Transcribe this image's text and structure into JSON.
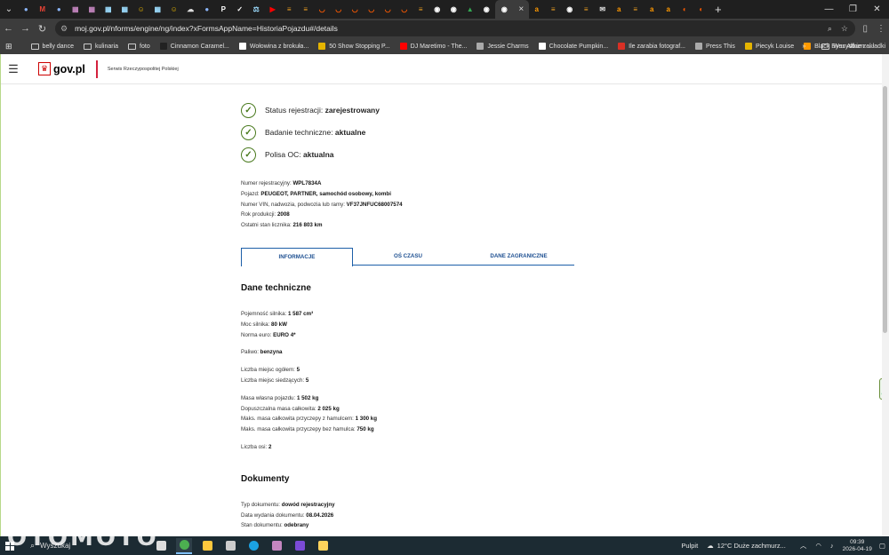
{
  "browser": {
    "tab_favicons": [
      {
        "icon": "globe-icon",
        "color": "#8ab4f8",
        "glyph": "●"
      },
      {
        "icon": "gmail-icon",
        "color": "#ea4335",
        "glyph": "M"
      },
      {
        "icon": "globe-icon",
        "color": "#8ab4f8",
        "glyph": "●"
      },
      {
        "icon": "page-icon",
        "color": "#c586c0",
        "glyph": "▦"
      },
      {
        "icon": "page-icon",
        "color": "#c586c0",
        "glyph": "▦"
      },
      {
        "icon": "page-icon",
        "color": "#9cdcfe",
        "glyph": "▦"
      },
      {
        "icon": "page-icon",
        "color": "#9cdcfe",
        "glyph": "▦"
      },
      {
        "icon": "smile-icon",
        "color": "#e5b400",
        "glyph": "☺"
      },
      {
        "icon": "page-icon",
        "color": "#9cdcfe",
        "glyph": "▦"
      },
      {
        "icon": "smile-icon",
        "color": "#e5b400",
        "glyph": "☺"
      },
      {
        "icon": "cloud-icon",
        "color": "#dddddd",
        "glyph": "☁"
      },
      {
        "icon": "globe-icon",
        "color": "#8ab4f8",
        "glyph": "●"
      },
      {
        "icon": "p-icon",
        "color": "#ffffff",
        "glyph": "P"
      },
      {
        "icon": "check-icon",
        "color": "#ffffff",
        "glyph": "✓"
      },
      {
        "icon": "scale-icon",
        "color": "#9cdcfe",
        "glyph": "⚖"
      },
      {
        "icon": "youtube-icon",
        "color": "#ff0000",
        "glyph": "▶"
      },
      {
        "icon": "olx-icon",
        "color": "#f0a020",
        "glyph": "≡"
      },
      {
        "icon": "olx-icon",
        "color": "#f0a020",
        "glyph": "≡"
      },
      {
        "icon": "allegro-icon",
        "color": "#ff5a00",
        "glyph": "◡"
      },
      {
        "icon": "allegro-icon",
        "color": "#ff5a00",
        "glyph": "◡"
      },
      {
        "icon": "allegro-icon",
        "color": "#ff5a00",
        "glyph": "◡"
      },
      {
        "icon": "allegro-icon",
        "color": "#ff5a00",
        "glyph": "◡"
      },
      {
        "icon": "allegro-icon",
        "color": "#ff5a00",
        "glyph": "◡"
      },
      {
        "icon": "allegro-icon",
        "color": "#ff5a00",
        "glyph": "◡"
      },
      {
        "icon": "olx-icon",
        "color": "#f0a020",
        "glyph": "≡"
      },
      {
        "icon": "globe-icon",
        "color": "#ffffff",
        "glyph": "◉"
      },
      {
        "icon": "globe-icon",
        "color": "#ffffff",
        "glyph": "◉"
      },
      {
        "icon": "tree-icon",
        "color": "#34a853",
        "glyph": "▲"
      },
      {
        "icon": "globe-icon",
        "color": "#ffffff",
        "glyph": "◉"
      }
    ],
    "active_tab_close": "×",
    "tab_favicons_right": [
      {
        "icon": "amazon-icon",
        "color": "#ff9900",
        "glyph": "a"
      },
      {
        "icon": "olx-icon",
        "color": "#f0a020",
        "glyph": "≡"
      },
      {
        "icon": "globe-icon",
        "color": "#ffffff",
        "glyph": "◉"
      },
      {
        "icon": "olx-icon",
        "color": "#f0a020",
        "glyph": "≡"
      },
      {
        "icon": "mail-icon",
        "color": "#dddddd",
        "glyph": "✉"
      },
      {
        "icon": "amazon-icon",
        "color": "#ff9900",
        "glyph": "a"
      },
      {
        "icon": "olx-icon",
        "color": "#f0a020",
        "glyph": "≡"
      },
      {
        "icon": "amazon-icon",
        "color": "#ff9900",
        "glyph": "a"
      },
      {
        "icon": "amazon-icon",
        "color": "#ff9900",
        "glyph": "a"
      },
      {
        "icon": "crescent-icon",
        "color": "#ff5a00",
        "glyph": "◐"
      },
      {
        "icon": "crescent-icon",
        "color": "#ff5a00",
        "glyph": "◐"
      }
    ],
    "new_tab": "+",
    "url": "moj.gov.pl/nforms/engine/ng/index?xFormsAppName=HistoriaPojazdu#/details",
    "bookmarks": [
      {
        "label": "belly dance",
        "icon": "folder-icon",
        "color": "",
        "folder": true
      },
      {
        "label": "kulinaria",
        "icon": "folder-icon",
        "color": "",
        "folder": true
      },
      {
        "label": "foto",
        "icon": "folder-icon",
        "color": "",
        "folder": true
      },
      {
        "label": "Cinnamon Caramel...",
        "icon": "bookmark-icon",
        "color": "#222222",
        "folder": false
      },
      {
        "label": "Wołowina z brokuła...",
        "icon": "bookmark-icon",
        "color": "#ffffff",
        "folder": false
      },
      {
        "label": "50 Show Stopping P...",
        "icon": "bookmark-icon",
        "color": "#e5b400",
        "folder": false
      },
      {
        "label": "DJ Maretimo - The...",
        "icon": "youtube-icon",
        "color": "#ff0000",
        "folder": false
      },
      {
        "label": "Jessie Charms",
        "icon": "globe-icon",
        "color": "#aaaaaa",
        "folder": false
      },
      {
        "label": "Chocolate Pumpkin...",
        "icon": "bookmark-icon",
        "color": "#ffffff",
        "folder": false
      },
      {
        "label": "Ile zarabia fotograf...",
        "icon": "bookmark-icon",
        "color": "#d93025",
        "folder": false
      },
      {
        "label": "Press This",
        "icon": "globe-icon",
        "color": "#aaaaaa",
        "folder": false
      },
      {
        "label": "Piecyk Louise",
        "icon": "bookmark-icon",
        "color": "#e5b400",
        "folder": false
      },
      {
        "label": "Black Eyes Album -...",
        "icon": "bookmark-icon",
        "color": "#ff9900",
        "folder": false
      }
    ],
    "bookmarks_more": "»",
    "all_bookmarks": "Wszystkie zakładki"
  },
  "site": {
    "logo_text": "gov.pl",
    "service_name": "Serwis Rzeczypospolitej Polskiej"
  },
  "statuses": [
    {
      "label": "Status rejestracji: ",
      "value": "zarejestrowany"
    },
    {
      "label": "Badanie techniczne: ",
      "value": "aktualne"
    },
    {
      "label": "Polisa OC: ",
      "value": "aktualna"
    }
  ],
  "vehicle": [
    {
      "label": "Numer rejestracyjny: ",
      "value": "WPL7834A"
    },
    {
      "label": "Pojazd: ",
      "value": "PEUGEOT, PARTNER, samochód osobowy, kombi"
    },
    {
      "label": "Numer VIN, nadwozia, podwozia lub ramy: ",
      "value": "VF37JNFUC68007574"
    },
    {
      "label": "Rok produkcji: ",
      "value": "2008"
    },
    {
      "label": "Ostatni stan licznika: ",
      "value": "216 803 km"
    }
  ],
  "page_tabs": [
    "INFORMACJE",
    "OŚ CZASU",
    "DANE ZAGRANICZNE"
  ],
  "tech_title": "Dane techniczne",
  "tech_groups": [
    [
      {
        "label": "Pojemność silnika: ",
        "value": "1 587 cm³"
      },
      {
        "label": "Moc silnika: ",
        "value": "80 kW"
      },
      {
        "label": "Norma euro: ",
        "value": "EURO 4*"
      }
    ],
    [
      {
        "label": "Paliwo: ",
        "value": "benzyna"
      }
    ],
    [
      {
        "label": "Liczba miejsc ogółem: ",
        "value": "5"
      },
      {
        "label": "Liczba miejsc siedzących: ",
        "value": "5"
      }
    ],
    [
      {
        "label": "Masa własna pojazdu: ",
        "value": "1 502 kg"
      },
      {
        "label": "Dopuszczalna masa całkowita: ",
        "value": "2 025 kg"
      },
      {
        "label": "Maks. masa całkowita przyczepy z hamulcem: ",
        "value": "1 300 kg"
      },
      {
        "label": "Maks. masa całkowita przyczepy bez hamulca: ",
        "value": "750 kg"
      }
    ],
    [
      {
        "label": "Liczba osi: ",
        "value": "2"
      }
    ]
  ],
  "docs_title": "Dokumenty",
  "documents": [
    {
      "label": "Typ dokumentu: ",
      "value": "dowód rejestracyjny"
    },
    {
      "label": "Data wydania dokumentu: ",
      "value": "08.04.2026"
    },
    {
      "label": "Stan dokumentu: ",
      "value": "odebrany"
    }
  ],
  "taskbar": {
    "search": "Wyszukaj",
    "watermark": "OTOMOTO",
    "apps": [
      {
        "icon": "task-view-icon",
        "color": "#dddddd"
      },
      {
        "icon": "chrome-icon",
        "color": "#4caf50"
      },
      {
        "icon": "store-icon",
        "color": "#ffc83d"
      },
      {
        "icon": "camera-icon",
        "color": "#cccccc"
      },
      {
        "icon": "edge-icon",
        "color": "#1ba1e2"
      },
      {
        "icon": "teams-icon",
        "color": "#c586c0"
      },
      {
        "icon": "onenote-icon",
        "color": "#7b4bd6"
      },
      {
        "icon": "explorer-icon",
        "color": "#ffd35c"
      }
    ],
    "desktop": "Pulpit",
    "weather": "12°C  Duże zachmurz...",
    "time": "09:39",
    "date": "2026-04-19"
  }
}
